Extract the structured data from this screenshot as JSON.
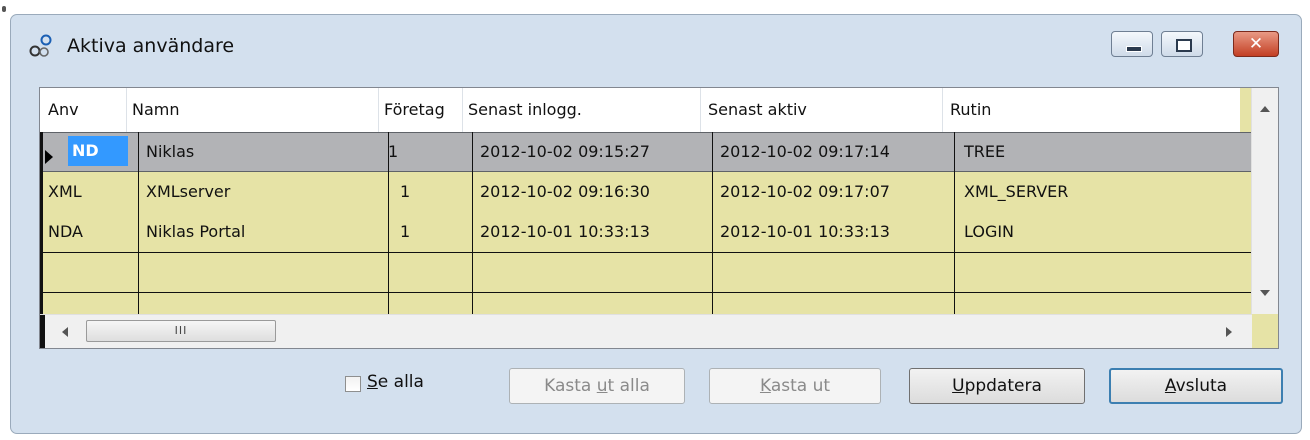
{
  "window": {
    "title": "Aktiva användare",
    "close_symbol": "✕"
  },
  "grid": {
    "columns": [
      "Anv",
      "Namn",
      "Företag",
      "Senast inlogg.",
      "Senast aktiv",
      "Rutin"
    ],
    "rows": [
      {
        "anv": "ND",
        "namn": "Niklas",
        "foretag": "1",
        "senast_inlogg": "2012-10-02 09:15:27",
        "senast_aktiv": "2012-10-02 09:17:14",
        "rutin": "TREE",
        "selected": true
      },
      {
        "anv": "XML",
        "namn": "XMLserver",
        "foretag": "1",
        "senast_inlogg": "2012-10-02 09:16:30",
        "senast_aktiv": "2012-10-02 09:17:07",
        "rutin": "XML_SERVER"
      },
      {
        "anv": "NDA",
        "namn": "Niklas Portal",
        "foretag": "1",
        "senast_inlogg": "2012-10-01 10:33:13",
        "senast_aktiv": "2012-10-01 10:33:13",
        "rutin": "LOGIN"
      }
    ],
    "hscroll_thumb_label": "III",
    "row_color": "#e6e3a6",
    "selected_row_color": "#b2b3b6",
    "selection_color": "#3399ff"
  },
  "controls": {
    "se_alla": {
      "accel": "S",
      "rest": "e alla",
      "checked": false
    },
    "kasta_ut_alla": {
      "before": "Kasta ",
      "accel": "u",
      "after": "t alla",
      "enabled": false
    },
    "kasta_ut": {
      "before": "",
      "accel": "K",
      "after": "asta ut",
      "enabled": false
    },
    "uppdatera": {
      "before": "",
      "accel": "U",
      "after": "ppdatera",
      "enabled": true
    },
    "avsluta": {
      "before": "",
      "accel": "A",
      "after": "vsluta",
      "enabled": true,
      "default": true
    }
  }
}
